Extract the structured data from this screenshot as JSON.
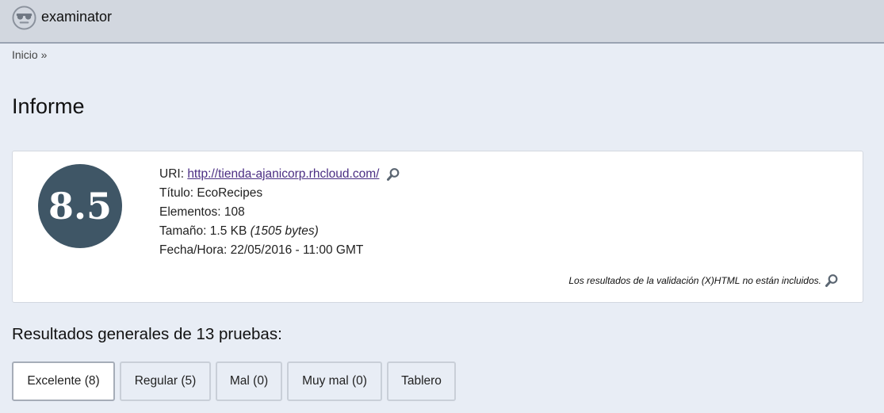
{
  "header": {
    "app_title": "examinator",
    "logo_icon": "sunglasses-face-icon"
  },
  "breadcrumb": {
    "home_label": "Inicio",
    "separator": "»"
  },
  "page": {
    "title": "Informe"
  },
  "report": {
    "score": "8.5",
    "score_color": "#3f5666",
    "uri_label": "URI:",
    "uri_value": "http://tienda-ajanicorp.rhcloud.com/",
    "title_label": "Título:",
    "title_value": "EcoRecipes",
    "elements_label": "Elementos:",
    "elements_value": "108",
    "size_label": "Tamaño:",
    "size_value": "1.5 KB",
    "size_bytes": "(1505 bytes)",
    "datetime_label": "Fecha/Hora:",
    "datetime_value": "22/05/2016 - 11:00 GMT",
    "validation_note": "Los resultados de la validación (X)HTML no están incluidos.",
    "inspect_icon": "magnifier-icon"
  },
  "results": {
    "heading": "Resultados generales de 13 pruebas:",
    "tabs": [
      {
        "label": "Excelente (8)",
        "active": true
      },
      {
        "label": "Regular (5)",
        "active": false
      },
      {
        "label": "Mal (0)",
        "active": false
      },
      {
        "label": "Muy mal (0)",
        "active": false
      },
      {
        "label": "Tablero",
        "active": false
      }
    ]
  }
}
